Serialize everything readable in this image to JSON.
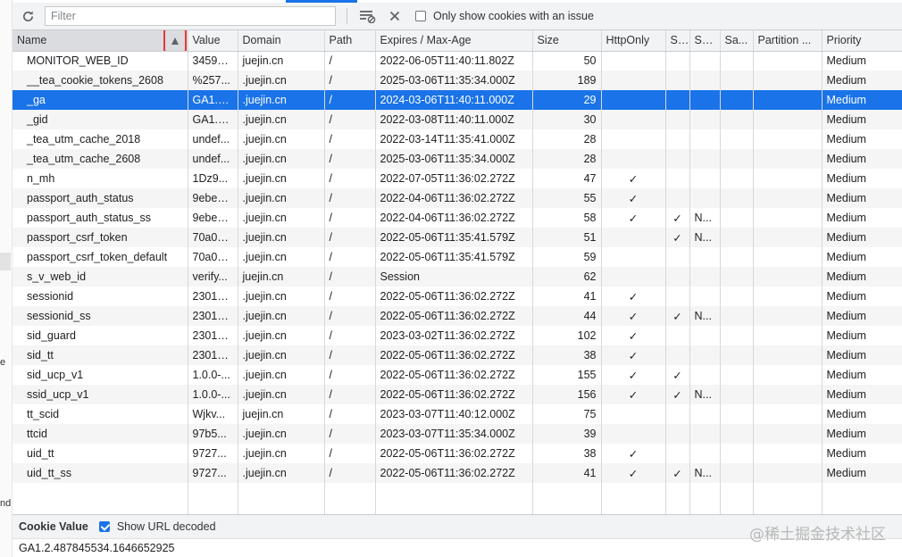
{
  "left_strip": {
    "frag1": "e",
    "frag2": "nd"
  },
  "toolbar": {
    "filter_placeholder": "Filter",
    "only_issue_label": "Only show cookies with an issue",
    "only_issue_checked": false
  },
  "table": {
    "headers": [
      "Name",
      "Value",
      "Domain",
      "Path",
      "Expires / Max-Age",
      "Size",
      "HttpOnly",
      "S...",
      "Sa...",
      "Sa...",
      "Partition ...",
      "Priority"
    ],
    "check": "✓",
    "rows": [
      {
        "name": "MONITOR_WEB_ID",
        "value": "34596...",
        "domain": "juejin.cn",
        "path": "/",
        "expires": "2022-06-05T11:40:11.802Z",
        "size": "50",
        "httponly": "",
        "secure": "",
        "samesite": "",
        "sameparty": "",
        "partition": "",
        "priority": "Medium"
      },
      {
        "name": "__tea_cookie_tokens_2608",
        "value": "%257...",
        "domain": ".juejin.cn",
        "path": "/",
        "expires": "2025-03-06T11:35:34.000Z",
        "size": "189",
        "httponly": "",
        "secure": "",
        "samesite": "",
        "sameparty": "",
        "partition": "",
        "priority": "Medium"
      },
      {
        "name": "_ga",
        "value": "GA1.2...",
        "domain": ".juejin.cn",
        "path": "/",
        "expires": "2024-03-06T11:40:11.000Z",
        "size": "29",
        "httponly": "",
        "secure": "",
        "samesite": "",
        "sameparty": "",
        "partition": "",
        "priority": "Medium",
        "selected": true
      },
      {
        "name": "_gid",
        "value": "GA1.2...",
        "domain": ".juejin.cn",
        "path": "/",
        "expires": "2022-03-08T11:40:11.000Z",
        "size": "30",
        "httponly": "",
        "secure": "",
        "samesite": "",
        "sameparty": "",
        "partition": "",
        "priority": "Medium"
      },
      {
        "name": "_tea_utm_cache_2018",
        "value": "undef...",
        "domain": ".juejin.cn",
        "path": "/",
        "expires": "2022-03-14T11:35:41.000Z",
        "size": "28",
        "httponly": "",
        "secure": "",
        "samesite": "",
        "sameparty": "",
        "partition": "",
        "priority": "Medium"
      },
      {
        "name": "_tea_utm_cache_2608",
        "value": "undef...",
        "domain": ".juejin.cn",
        "path": "/",
        "expires": "2025-03-06T11:35:34.000Z",
        "size": "28",
        "httponly": "",
        "secure": "",
        "samesite": "",
        "sameparty": "",
        "partition": "",
        "priority": "Medium"
      },
      {
        "name": "n_mh",
        "value": "1Dz9...",
        "domain": ".juejin.cn",
        "path": "/",
        "expires": "2022-07-05T11:36:02.272Z",
        "size": "47",
        "httponly": "✓",
        "secure": "",
        "samesite": "",
        "sameparty": "",
        "partition": "",
        "priority": "Medium"
      },
      {
        "name": "passport_auth_status",
        "value": "9ebe7...",
        "domain": ".juejin.cn",
        "path": "/",
        "expires": "2022-04-06T11:36:02.272Z",
        "size": "55",
        "httponly": "✓",
        "secure": "",
        "samesite": "",
        "sameparty": "",
        "partition": "",
        "priority": "Medium"
      },
      {
        "name": "passport_auth_status_ss",
        "value": "9ebe7...",
        "domain": ".juejin.cn",
        "path": "/",
        "expires": "2022-04-06T11:36:02.272Z",
        "size": "58",
        "httponly": "✓",
        "secure": "✓",
        "samesite": "N...",
        "sameparty": "",
        "partition": "",
        "priority": "Medium"
      },
      {
        "name": "passport_csrf_token",
        "value": "70a06...",
        "domain": ".juejin.cn",
        "path": "/",
        "expires": "2022-05-06T11:35:41.579Z",
        "size": "51",
        "httponly": "",
        "secure": "✓",
        "samesite": "N...",
        "sameparty": "",
        "partition": "",
        "priority": "Medium"
      },
      {
        "name": "passport_csrf_token_default",
        "value": "70a06...",
        "domain": ".juejin.cn",
        "path": "/",
        "expires": "2022-05-06T11:35:41.579Z",
        "size": "59",
        "httponly": "",
        "secure": "",
        "samesite": "",
        "sameparty": "",
        "partition": "",
        "priority": "Medium"
      },
      {
        "name": "s_v_web_id",
        "value": "verify...",
        "domain": "juejin.cn",
        "path": "/",
        "expires": "Session",
        "size": "62",
        "httponly": "",
        "secure": "",
        "samesite": "",
        "sameparty": "",
        "partition": "",
        "priority": "Medium"
      },
      {
        "name": "sessionid",
        "value": "23018...",
        "domain": ".juejin.cn",
        "path": "/",
        "expires": "2022-05-06T11:36:02.272Z",
        "size": "41",
        "httponly": "✓",
        "secure": "",
        "samesite": "",
        "sameparty": "",
        "partition": "",
        "priority": "Medium"
      },
      {
        "name": "sessionid_ss",
        "value": "23018...",
        "domain": ".juejin.cn",
        "path": "/",
        "expires": "2022-05-06T11:36:02.272Z",
        "size": "44",
        "httponly": "✓",
        "secure": "✓",
        "samesite": "N...",
        "sameparty": "",
        "partition": "",
        "priority": "Medium"
      },
      {
        "name": "sid_guard",
        "value": "23018...",
        "domain": ".juejin.cn",
        "path": "/",
        "expires": "2023-03-02T11:36:02.272Z",
        "size": "102",
        "httponly": "✓",
        "secure": "",
        "samesite": "",
        "sameparty": "",
        "partition": "",
        "priority": "Medium"
      },
      {
        "name": "sid_tt",
        "value": "23018...",
        "domain": ".juejin.cn",
        "path": "/",
        "expires": "2022-05-06T11:36:02.272Z",
        "size": "38",
        "httponly": "✓",
        "secure": "",
        "samesite": "",
        "sameparty": "",
        "partition": "",
        "priority": "Medium"
      },
      {
        "name": "sid_ucp_v1",
        "value": "1.0.0-...",
        "domain": ".juejin.cn",
        "path": "/",
        "expires": "2022-05-06T11:36:02.272Z",
        "size": "155",
        "httponly": "✓",
        "secure": "✓",
        "samesite": "",
        "sameparty": "",
        "partition": "",
        "priority": "Medium"
      },
      {
        "name": "ssid_ucp_v1",
        "value": "1.0.0-...",
        "domain": ".juejin.cn",
        "path": "/",
        "expires": "2022-05-06T11:36:02.272Z",
        "size": "156",
        "httponly": "✓",
        "secure": "✓",
        "samesite": "N...",
        "sameparty": "",
        "partition": "",
        "priority": "Medium"
      },
      {
        "name": "tt_scid",
        "value": "Wjkv...",
        "domain": "juejin.cn",
        "path": "/",
        "expires": "2023-03-07T11:40:12.000Z",
        "size": "75",
        "httponly": "",
        "secure": "",
        "samesite": "",
        "sameparty": "",
        "partition": "",
        "priority": "Medium"
      },
      {
        "name": "ttcid",
        "value": "97b5...",
        "domain": ".juejin.cn",
        "path": "/",
        "expires": "2023-03-07T11:35:34.000Z",
        "size": "39",
        "httponly": "",
        "secure": "",
        "samesite": "",
        "sameparty": "",
        "partition": "",
        "priority": "Medium"
      },
      {
        "name": "uid_tt",
        "value": "9727...",
        "domain": ".juejin.cn",
        "path": "/",
        "expires": "2022-05-06T11:36:02.272Z",
        "size": "38",
        "httponly": "✓",
        "secure": "",
        "samesite": "",
        "sameparty": "",
        "partition": "",
        "priority": "Medium"
      },
      {
        "name": "uid_tt_ss",
        "value": "9727...",
        "domain": ".juejin.cn",
        "path": "/",
        "expires": "2022-05-06T11:36:02.272Z",
        "size": "41",
        "httponly": "✓",
        "secure": "✓",
        "samesite": "N...",
        "sameparty": "",
        "partition": "",
        "priority": "Medium"
      }
    ]
  },
  "bottom": {
    "title": "Cookie Value",
    "show_url_decoded_label": "Show URL decoded",
    "show_url_decoded_checked": true,
    "value": "GA1.2.487845534.1646652925"
  },
  "watermark": "@稀土掘金技术社区",
  "colors": {
    "selection": "#1a73e8",
    "highlight_box": "#e53935"
  }
}
